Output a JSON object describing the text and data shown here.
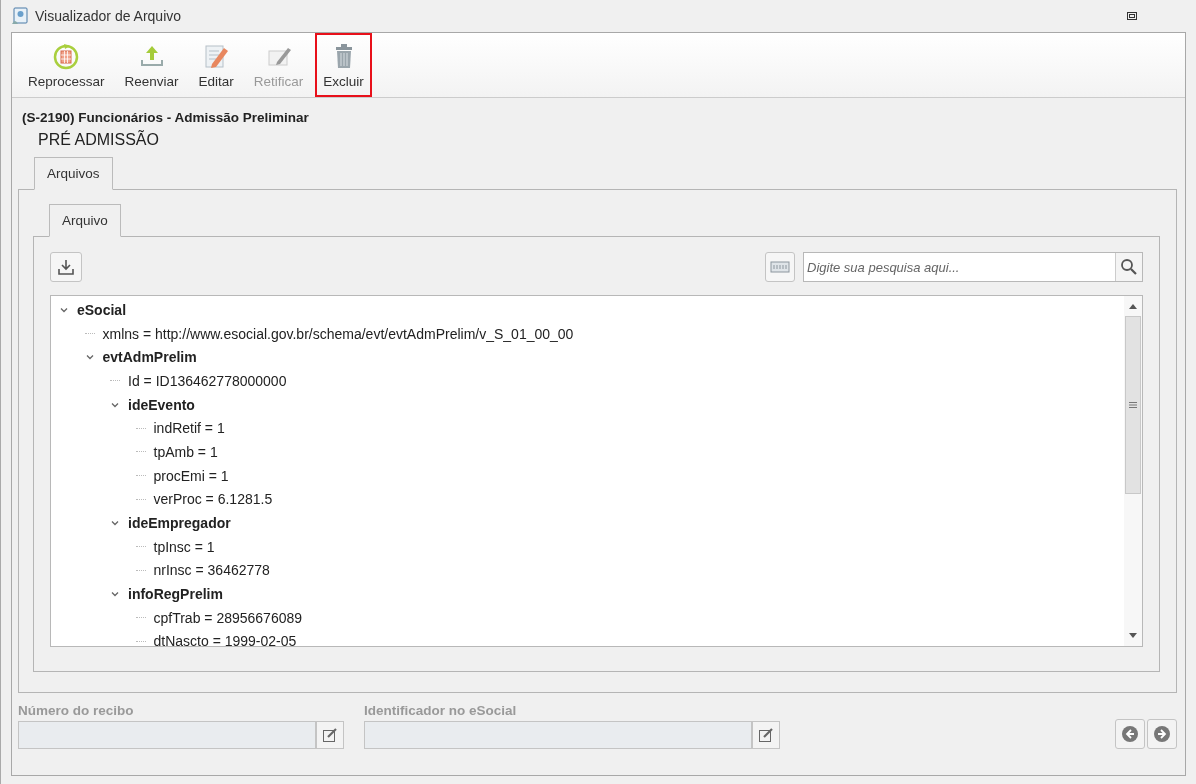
{
  "window": {
    "title": "Visualizador de Arquivo"
  },
  "toolbar": [
    {
      "kind": "reprocess",
      "label": "Reprocessar",
      "disabled": false,
      "highlighted": false
    },
    {
      "kind": "resend",
      "label": "Reenviar",
      "disabled": false,
      "highlighted": false
    },
    {
      "kind": "edit",
      "label": "Editar",
      "disabled": false,
      "highlighted": false
    },
    {
      "kind": "rectify",
      "label": "Retificar",
      "disabled": true,
      "highlighted": false
    },
    {
      "kind": "delete",
      "label": "Excluir",
      "disabled": false,
      "highlighted": true
    }
  ],
  "header": {
    "event": "(S-2190) Funcionários - Admissão Preliminar",
    "subtitle": "PRÉ ADMISSÃO"
  },
  "outer_tabs": [
    {
      "label": "Arquivos",
      "selected": true
    }
  ],
  "inner_tabs": [
    {
      "label": "Arquivo",
      "selected": true
    }
  ],
  "search": {
    "placeholder": "Digite sua pesquisa aqui..."
  },
  "tree": [
    {
      "kind": "element",
      "label": "eSocial",
      "expanded": true,
      "children": [
        {
          "kind": "attribute",
          "label": "xmlns = http://www.esocial.gov.br/schema/evt/evtAdmPrelim/v_S_01_00_00"
        },
        {
          "kind": "element",
          "label": "evtAdmPrelim",
          "expanded": true,
          "children": [
            {
              "kind": "attribute",
              "label": "Id = ID136462778000000"
            },
            {
              "kind": "element",
              "label": "ideEvento",
              "expanded": true,
              "children": [
                {
                  "kind": "attribute",
                  "label": "indRetif = 1"
                },
                {
                  "kind": "attribute",
                  "label": "tpAmb = 1"
                },
                {
                  "kind": "attribute",
                  "label": "procEmi = 1"
                },
                {
                  "kind": "attribute",
                  "label": "verProc = 6.1281.5"
                }
              ]
            },
            {
              "kind": "element",
              "label": "ideEmpregador",
              "expanded": true,
              "children": [
                {
                  "kind": "attribute",
                  "label": "tpInsc = 1"
                },
                {
                  "kind": "attribute",
                  "label": "nrInsc = 36462778"
                }
              ]
            },
            {
              "kind": "element",
              "label": "infoRegPrelim",
              "expanded": true,
              "children": [
                {
                  "kind": "attribute",
                  "label": "cpfTrab = 28956676089"
                },
                {
                  "kind": "attribute",
                  "label": "dtNascto = 1999-02-05"
                }
              ]
            }
          ]
        }
      ]
    }
  ],
  "fields": [
    {
      "label": "Número do recibo"
    },
    {
      "label": "Identificador no eSocial"
    }
  ]
}
